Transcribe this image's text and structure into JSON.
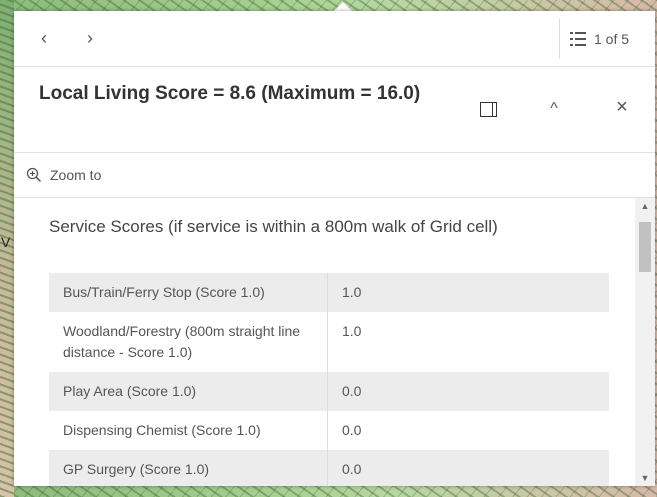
{
  "map": {
    "label_fragment": "V"
  },
  "nav": {
    "prev_label": "‹",
    "next_label": "›",
    "feature_count": "1 of 5"
  },
  "header": {
    "title": "Local Living Score = 8.6 (Maximum = 16.0)",
    "collapse_label": "^",
    "close_label": "×"
  },
  "actions": {
    "zoom_label": "Zoom to"
  },
  "content": {
    "section_title": "Service Scores (if service is within a 800m walk of Grid cell)",
    "rows": [
      {
        "field": "Bus/Train/Ferry Stop (Score 1.0)",
        "value": "1.0"
      },
      {
        "field": "Woodland/Forestry (800m straight line distance - Score 1.0)",
        "value": "1.0"
      },
      {
        "field": "Play Area (Score 1.0)",
        "value": "0.0"
      },
      {
        "field": "Dispensing Chemist (Score 1.0)",
        "value": "0.0"
      },
      {
        "field": "GP Surgery (Score 1.0)",
        "value": "0.0"
      }
    ]
  },
  "colors": {
    "row_shade": "#ececec",
    "text": "#555555",
    "title": "#333333"
  },
  "icons": [
    "chevron-left-icon",
    "chevron-right-icon",
    "list-icon",
    "dock-icon",
    "chevron-up-icon",
    "close-icon",
    "zoom-in-icon"
  ]
}
